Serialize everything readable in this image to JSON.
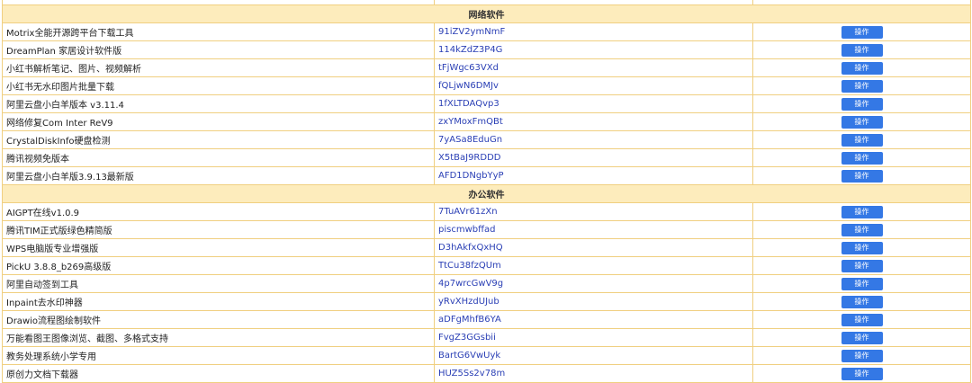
{
  "sections": [
    {
      "title": "网络软件",
      "rows": [
        {
          "name": "Motrix全能开源跨平台下载工具",
          "code": "91iZV2ymNmF",
          "action": "操作"
        },
        {
          "name": "DreamPlan 家居设计软件版",
          "code": "114kZdZ3P4G",
          "action": "操作"
        },
        {
          "name": "小红书解析笔记、图片、视频解析",
          "code": "tFjWgc63VXd",
          "action": "操作"
        },
        {
          "name": "小红书无水印图片批量下载",
          "code": "fQLjwN6DMJv",
          "action": "操作"
        },
        {
          "name": "阿里云盘小白羊版本 v3.11.4",
          "code": "1fXLTDAQvp3",
          "action": "操作"
        },
        {
          "name": "网络修复Com Inter ReV9",
          "code": "zxYMoxFmQBt",
          "action": "操作"
        },
        {
          "name": "CrystalDiskInfo硬盘检测",
          "code": "7yASa8EduGn",
          "action": "操作"
        },
        {
          "name": "腾讯视频免版本",
          "code": "X5tBaJ9RDDD",
          "action": "操作"
        },
        {
          "name": "阿里云盘小白羊版3.9.13最新版",
          "code": "AFD1DNgbYyP",
          "action": "操作"
        }
      ]
    },
    {
      "title": "办公软件",
      "rows": [
        {
          "name": "AIGPT在线v1.0.9",
          "code": "7TuAVr61zXn",
          "action": "操作"
        },
        {
          "name": "腾讯TIM正式版绿色精简版",
          "code": "piscmwbffad",
          "action": "操作"
        },
        {
          "name": "WPS电脑版专业增强版",
          "code": "D3hAkfxQxHQ",
          "action": "操作"
        },
        {
          "name": "PickU 3.8.8_b269高级版",
          "code": "TtCu38fzQUm",
          "action": "操作"
        },
        {
          "name": "阿里自动签到工具",
          "code": "4p7wrcGwV9g",
          "action": "操作"
        },
        {
          "name": "Inpaint去水印神器",
          "code": "yRvXHzdUJub",
          "action": "操作"
        },
        {
          "name": "Drawio流程图绘制软件",
          "code": "aDFgMhfB6YA",
          "action": "操作"
        },
        {
          "name": "万能看图王图像浏览、截图、多格式支持",
          "code": "FvgZ3GGsbii",
          "action": "操作"
        },
        {
          "name": "教务处理系统小学专用",
          "code": "BartG6VwUyk",
          "action": "操作"
        },
        {
          "name": "原创力文档下载器",
          "code": "HUZ5Ss2v78m",
          "action": "操作"
        }
      ]
    }
  ]
}
